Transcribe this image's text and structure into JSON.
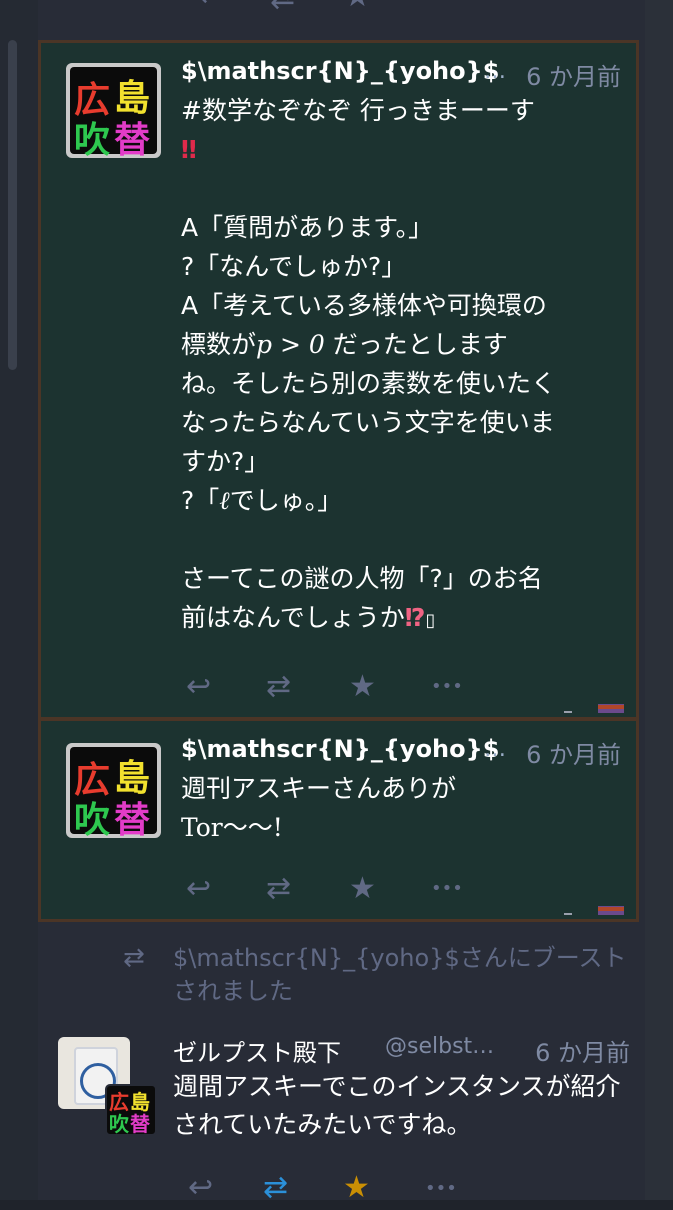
{
  "icons": {
    "reply": "reply-icon",
    "boost": "boost-icon",
    "favourite": "star-icon",
    "more": "more-icon"
  },
  "colors": {
    "background": "#282c37",
    "status_highlight": "#1c3330",
    "status_border": "#4b3526",
    "name_color": "#ffffff",
    "muted_text": "#606984",
    "boost_active": "#2b90d9",
    "favourite_active": "#ca8f04"
  },
  "statuses": [
    {
      "avatar_text": [
        "広",
        "島",
        "吹",
        "替"
      ],
      "display_name": "$\\mathscr{N}_{yoho}$",
      "ellipsis": "…",
      "time": "6 か月前",
      "content_lines": [
        "#数学なぞなぞ 行っきまーーす",
        "‼",
        "",
        "A「質問があります。」",
        "?「なんでしゅか?」",
        "A「考えている多様体や可換環の",
        "標数が",
        "p > 0",
        " だったとします",
        "ね。そしたら別の素数を使いたく",
        "なったらなんていう文字を使いま",
        "すか?」",
        "?「",
        "ℓ",
        "でしゅ。」",
        "",
        "さーてこの謎の人物「?」のお名",
        "前はなんでしょうか",
        "⁉",
        "▯"
      ]
    },
    {
      "avatar_text": [
        "広",
        "島",
        "吹",
        "替"
      ],
      "display_name": "$\\mathscr{N}_{yoho}$",
      "ellipsis": "…",
      "time": "6 か月前",
      "content_lines": [
        "週刊アスキーさんありが",
        "Tor〜〜!"
      ]
    }
  ],
  "boost_notice": {
    "text": "$\\mathscr{N}_{yoho}$さんにブーストされました"
  },
  "status3": {
    "display_name": "ゼルプスト殿下",
    "handle": "@selbst…",
    "time": "6 か月前",
    "mini_avatar_text": [
      "広",
      "島",
      "吹",
      "替"
    ],
    "content": "週間アスキーでこのインスタンスが紹介されていたみたいですね。"
  },
  "glyphs": {
    "reply": "↩",
    "boost": "⇄",
    "star": "★",
    "more": "•••"
  }
}
